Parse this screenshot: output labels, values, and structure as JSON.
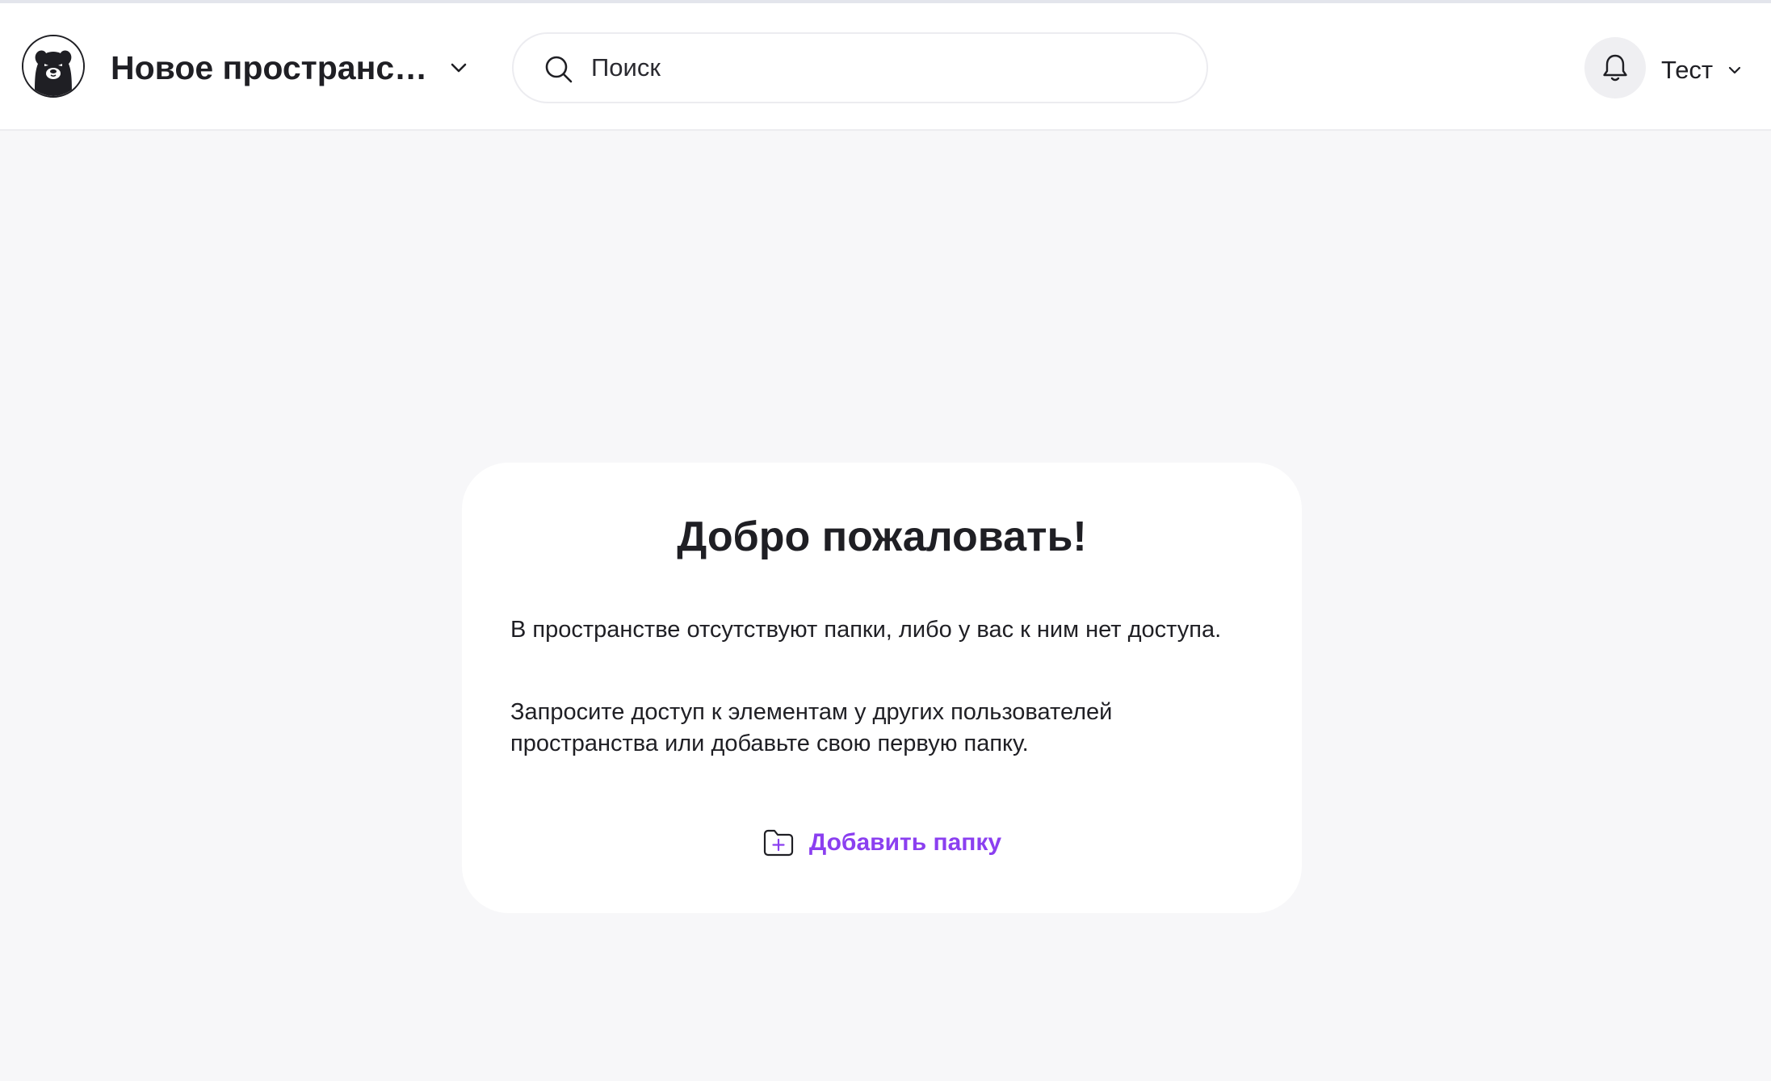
{
  "header": {
    "space_name": "Новое пространство",
    "search_placeholder": "Поиск",
    "user_name": "Тест",
    "icons": {
      "logo": "bear-logo",
      "space_menu": "chevron-down-icon",
      "search": "search-icon",
      "notifications": "bell-icon",
      "user_menu": "chevron-down-icon"
    }
  },
  "welcome_card": {
    "title": "Добро пожаловать!",
    "message_1": "В пространстве отсутствуют папки, либо у вас к ним нет доступа.",
    "message_2": "Запросите доступ к элементам у других пользователей пространства или добавьте свою первую папку.",
    "add_folder_label": "Добавить папку",
    "add_folder_icon": "folder-plus-icon"
  },
  "colors": {
    "accent": "#8b3ff0",
    "background": "#f7f7f9",
    "card": "#ffffff",
    "text": "#1f1f24"
  }
}
